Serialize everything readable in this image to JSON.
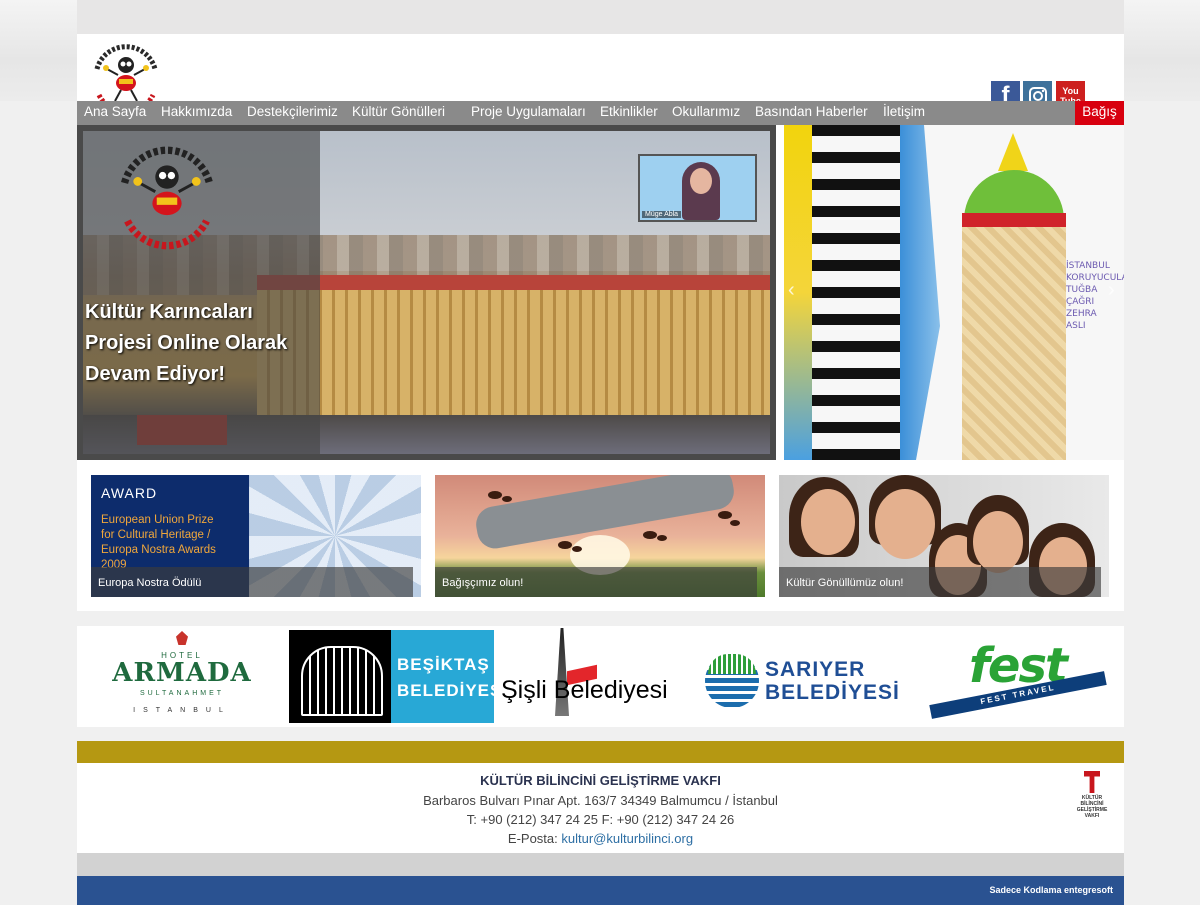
{
  "nav": {
    "items": [
      "Ana Sayfa",
      "Hakkımızda",
      "Destekçilerimiz",
      "Kültür Gönülleri",
      "Proje Uygulamaları",
      "Etkinlikler",
      "Okullarımız",
      "Basından Haberler",
      "İletişim"
    ],
    "donate": "Bağış"
  },
  "social": {
    "facebook_glyph": "f",
    "youtube_top": "You",
    "youtube_bottom": "Tube"
  },
  "slider": {
    "headline_line1": "Kültür Karıncaları",
    "headline_line2": "Projesi Online Olarak",
    "headline_line3": "Devam Ediyor!",
    "video_name": "Müge Abla",
    "drawing_text": [
      "İSTANBUL",
      "KORUYUCULARI",
      "TUĞBA",
      "ÇAĞRI",
      "ZEHRA",
      "ASLI"
    ]
  },
  "cards": [
    {
      "caption": "Europa Nostra Ödülü",
      "award_title": "AWARD",
      "award_text": [
        "European Union Prize",
        "for Cultural Heritage /",
        "Europa Nostra Awards",
        "2009"
      ]
    },
    {
      "caption": "Bağışçımız olun!"
    },
    {
      "caption": "Kültür Gönüllümüz olun!"
    }
  ],
  "sponsors": {
    "armada": {
      "hotel": "HOTEL",
      "name": "ARMADA",
      "sub": "SULTANAHMET",
      "city": "ISTANBUL"
    },
    "besiktas": {
      "line1": "BEŞİKTAŞ",
      "line2": "BELEDİYESİ"
    },
    "sisli": {
      "text": "Şişli Belediyesi"
    },
    "sariyer": {
      "line1": "SARIYER",
      "line2": "BELEDİYESİ"
    },
    "fest": {
      "word": "fest",
      "band": "FEST TRAVEL"
    }
  },
  "footer": {
    "org": "KÜLTÜR BİLİNCİNİ GELİŞTİRME VAKFI",
    "address": "Barbaros Bulvarı Pınar Apt. 163/7 34349 Balmumcu / İstanbul",
    "phone": "T: +90 (212) 347 24 25 F: +90 (212) 347 24 26",
    "email_label": "E-Posta: ",
    "email": "kultur@kulturbilinci.org",
    "logo_text": [
      "KÜLTÜR",
      "BİLİNCİNİ",
      "GELİŞTİRME",
      "VAKFI"
    ],
    "credit": "Sadece Kodlama entegresoft"
  },
  "colors": {
    "nav": "#8a8a8a",
    "donate": "#d8000f",
    "gold": "#b59812",
    "footer_blue": "#2a5291"
  },
  "icons": [
    "facebook-icon",
    "instagram-icon",
    "youtube-icon",
    "slider-prev-icon",
    "slider-next-icon"
  ]
}
